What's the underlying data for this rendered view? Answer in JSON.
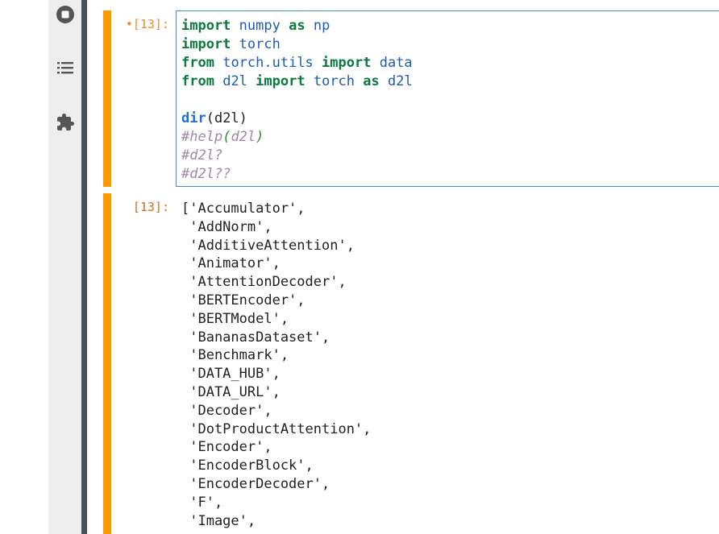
{
  "sidebar": {
    "icons": [
      "stop-circle-icon",
      "table-of-contents-icon",
      "extension-puzzle-icon"
    ]
  },
  "input_cell": {
    "prompt": "•[13]:",
    "code_lines": [
      [
        {
          "t": "import",
          "c": "kw"
        },
        {
          "t": " ",
          "c": "pl"
        },
        {
          "t": "numpy",
          "c": "nm"
        },
        {
          "t": " ",
          "c": "pl"
        },
        {
          "t": "as",
          "c": "kw"
        },
        {
          "t": " ",
          "c": "pl"
        },
        {
          "t": "np",
          "c": "nm"
        }
      ],
      [
        {
          "t": "import",
          "c": "kw"
        },
        {
          "t": " ",
          "c": "pl"
        },
        {
          "t": "torch",
          "c": "nm"
        }
      ],
      [
        {
          "t": "from",
          "c": "kw"
        },
        {
          "t": " ",
          "c": "pl"
        },
        {
          "t": "torch.utils",
          "c": "nm"
        },
        {
          "t": " ",
          "c": "pl"
        },
        {
          "t": "import",
          "c": "kw"
        },
        {
          "t": " ",
          "c": "pl"
        },
        {
          "t": "data",
          "c": "nm"
        }
      ],
      [
        {
          "t": "from",
          "c": "kw"
        },
        {
          "t": " ",
          "c": "pl"
        },
        {
          "t": "d2l",
          "c": "nm"
        },
        {
          "t": " ",
          "c": "pl"
        },
        {
          "t": "import",
          "c": "kw"
        },
        {
          "t": " ",
          "c": "pl"
        },
        {
          "t": "torch",
          "c": "nm"
        },
        {
          "t": " ",
          "c": "pl"
        },
        {
          "t": "as",
          "c": "kw"
        },
        {
          "t": " ",
          "c": "pl"
        },
        {
          "t": "d2l",
          "c": "nm"
        }
      ],
      [],
      [
        {
          "t": "dir",
          "c": "fn"
        },
        {
          "t": "(d2l)",
          "c": "pl"
        }
      ],
      [
        {
          "t": "#help",
          "c": "cm"
        },
        {
          "t": "(",
          "c": "cm-paren"
        },
        {
          "t": "d2l",
          "c": "cm"
        },
        {
          "t": ")",
          "c": "cm-paren"
        }
      ],
      [
        {
          "t": "#d2l?",
          "c": "cm"
        }
      ],
      [
        {
          "t": "#d2l??",
          "c": "cm"
        }
      ]
    ]
  },
  "output_cell": {
    "prompt": "[13]:",
    "lines": [
      "['Accumulator',",
      " 'AddNorm',",
      " 'AdditiveAttention',",
      " 'Animator',",
      " 'AttentionDecoder',",
      " 'BERTEncoder',",
      " 'BERTModel',",
      " 'BananasDataset',",
      " 'Benchmark',",
      " 'DATA_HUB',",
      " 'DATA_URL',",
      " 'Decoder',",
      " 'DotProductAttention',",
      " 'Encoder',",
      " 'EncoderBlock',",
      " 'EncoderDecoder',",
      " 'F',",
      " 'Image',"
    ]
  },
  "colors": {
    "cell_bar": "#ff9800",
    "editor_border": "#3f8cd6",
    "sidebar_bg": "#eeeeee",
    "sidebar_divider": "#44525c"
  }
}
